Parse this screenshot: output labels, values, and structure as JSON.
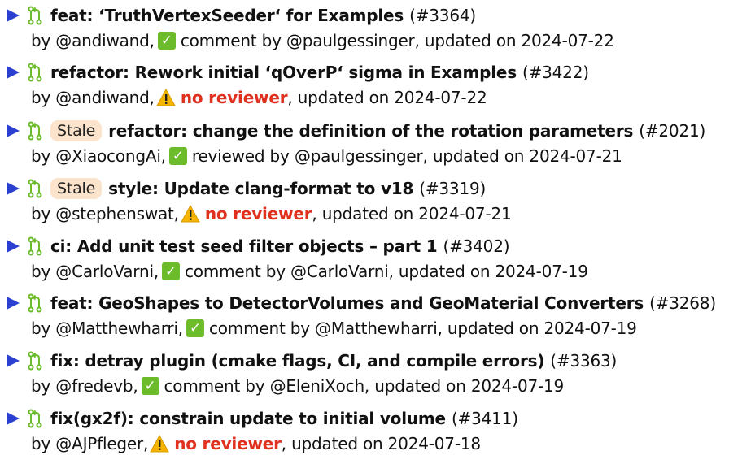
{
  "colors": {
    "arrow": "#2b3fd1",
    "pr_icon": "#6cbb2b",
    "check_bg": "#6cbb2b",
    "warning": "#f4b400",
    "no_reviewer": "#e0301e",
    "stale_bg": "#fbe3cc"
  },
  "icons": {
    "expand": "triangle-right-icon",
    "pr": "git-pull-request-icon",
    "approved": "check-mark-icon",
    "warning": "warning-icon"
  },
  "prs": [
    {
      "stale": "",
      "title": "feat: ‘TruthVertexSeeder‘ for Examples",
      "number": "(#3364)",
      "author": "by @andiwand,",
      "status_type": "check",
      "status_text": "comment by @paulgessinger",
      "updated": ", updated on 2024-07-22"
    },
    {
      "stale": "",
      "title": "refactor: Rework initial ‘qOverP‘ sigma in Examples",
      "number": "(#3422)",
      "author": "by @andiwand,",
      "status_type": "warn",
      "status_text": "no reviewer",
      "updated": ", updated on 2024-07-22"
    },
    {
      "stale": "Stale",
      "title": "refactor: change the definition of the rotation parameters",
      "number": "(#2021)",
      "author": "by @XiaocongAi,",
      "status_type": "check",
      "status_text": "reviewed by @paulgessinger",
      "updated": ", updated on 2024-07-21"
    },
    {
      "stale": "Stale",
      "title": "style: Update clang-format to v18",
      "number": "(#3319)",
      "author": "by @stephenswat,",
      "status_type": "warn",
      "status_text": "no reviewer",
      "updated": ", updated on 2024-07-21"
    },
    {
      "stale": "",
      "title": "ci: Add unit test seed filter objects – part 1",
      "number": "(#3402)",
      "author": "by @CarloVarni,",
      "status_type": "check",
      "status_text": "comment by @CarloVarni",
      "updated": ", updated on 2024-07-19"
    },
    {
      "stale": "",
      "title": "feat: GeoShapes to DetectorVolumes and GeoMaterial Converters",
      "number": "(#3268)",
      "author": "by @Matthewharri,",
      "status_type": "check",
      "status_text": "comment by @Matthewharri",
      "updated": ", updated on 2024-07-19"
    },
    {
      "stale": "",
      "title": "fix: detray plugin (cmake flags, CI, and compile errors)",
      "number": "(#3363)",
      "author": "by @fredevb,",
      "status_type": "check",
      "status_text": "comment by @EleniXoch",
      "updated": ", updated on 2024-07-19"
    },
    {
      "stale": "",
      "title": "fix(gx2f): constrain update to initial volume",
      "number": "(#3411)",
      "author": "by @AJPfleger,",
      "status_type": "warn",
      "status_text": "no reviewer",
      "updated": ", updated on 2024-07-18"
    }
  ]
}
